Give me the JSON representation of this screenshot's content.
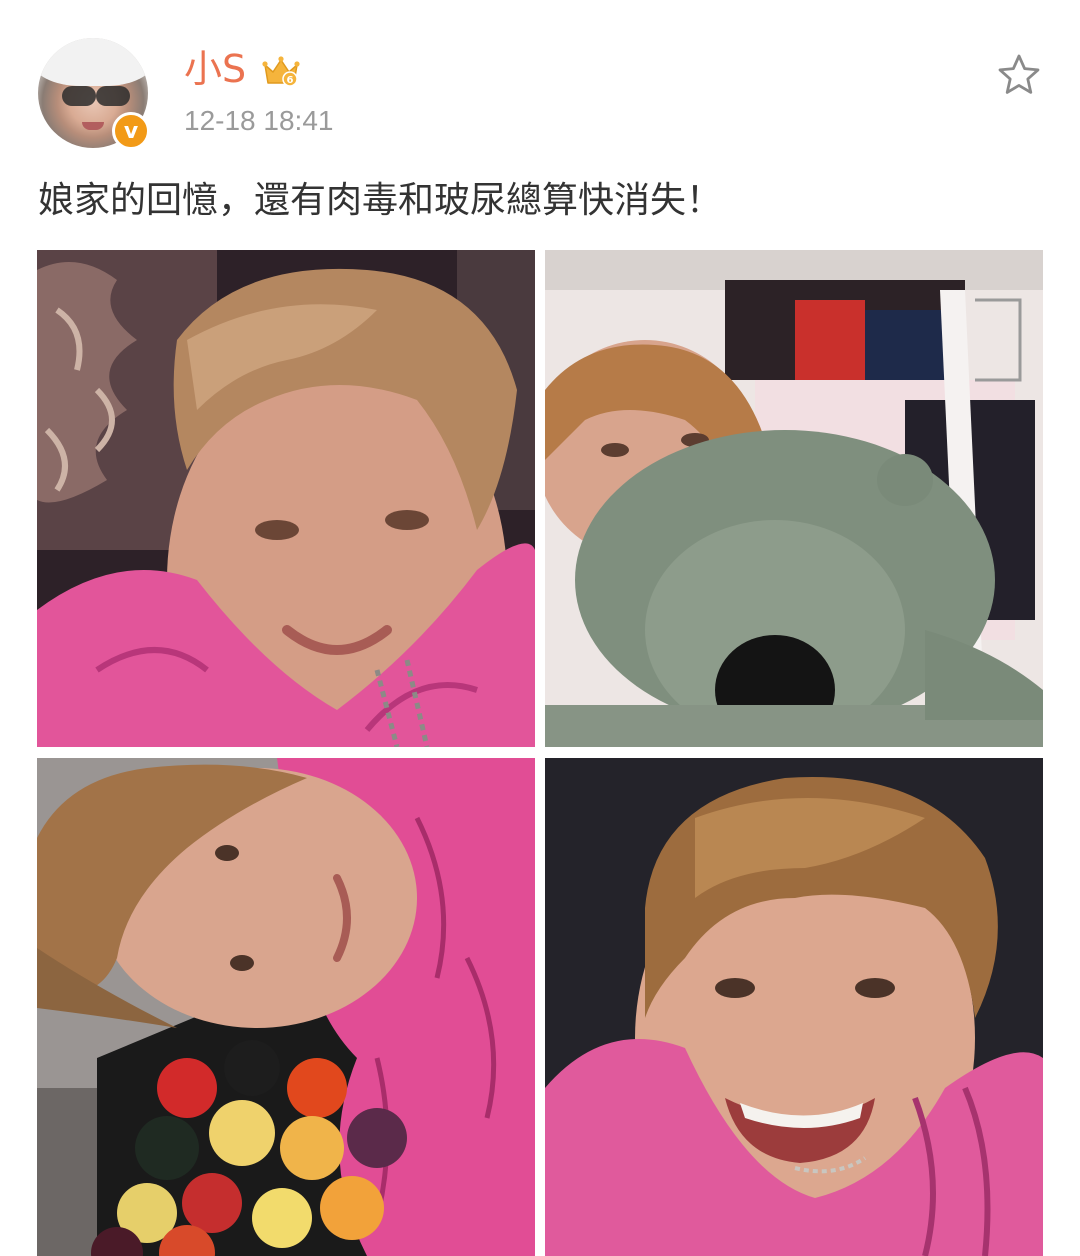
{
  "post": {
    "author": {
      "name": "小S",
      "avatar_icon": "user-avatar",
      "verified_icon": "verified-v-badge",
      "verified_mark": "v",
      "member_icon": "crown-member-icon",
      "member_level": "6"
    },
    "timestamp": "12-18 18:41",
    "favorite_icon": "star-outline-icon",
    "text": "娘家的回憶，還有肉毒和玻尿總算快消失！",
    "images": [
      {
        "alt": "selfie-pink-hoodie-on-pillow"
      },
      {
        "alt": "selfie-with-green-plush-bear"
      },
      {
        "alt": "selfie-lying-by-billiard-balls"
      },
      {
        "alt": "smiling-selfie-dark-background"
      }
    ]
  },
  "colors": {
    "username": "#eb7350",
    "timestamp": "#9a9a9a",
    "body_text": "#333333",
    "verified_badge": "#f29a17",
    "crown": "#f5b43c",
    "star_outline": "#8a8a8a"
  }
}
